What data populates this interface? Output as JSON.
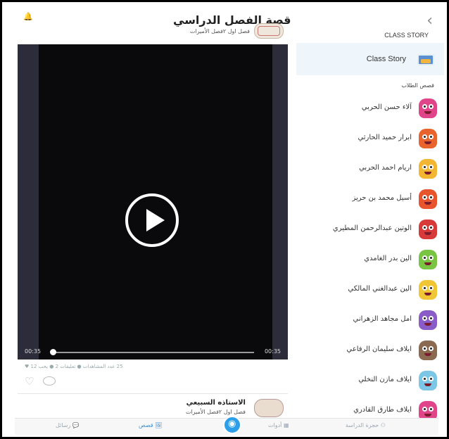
{
  "header": {
    "title": "قصة الفصل الدراسي",
    "back_icon": "chevron-left-icon",
    "class_story_caption": "CLASS STORY"
  },
  "feed": {
    "post1": {
      "subtitle": "فصل اول ٢فصل الأميرات",
      "avatar_text": "الاستاذة السبيعي",
      "video": {
        "time_elapsed": "00:35",
        "time_total": "00:35",
        "progress": 0.0
      },
      "stats": "25 عدد المشاهدات ● تعليقات 2 ● يحب 12 ♥"
    },
    "post2": {
      "author": "الاستاذه السبيعي",
      "subtitle": "فصل اول ٢فصل الأميرات",
      "ago": "712d"
    }
  },
  "sidebar": {
    "class_story_label": "Class Story",
    "section_caption": "قصص الطلاب",
    "students": [
      {
        "name": "آلاء حسن الحربي",
        "color": "#e0458a"
      },
      {
        "name": "ابرار حميد الحارثي",
        "color": "#e8642c"
      },
      {
        "name": "اريام احمد الحربي",
        "color": "#f2b632"
      },
      {
        "name": "أسيل محمد بن حريز",
        "color": "#e8542c"
      },
      {
        "name": "الوتين عبدالرحمن المطيري",
        "color": "#d83a3a"
      },
      {
        "name": "الين بدر الغامدي",
        "color": "#7ac443"
      },
      {
        "name": "الين عبدالغني المالكي",
        "color": "#f0c634"
      },
      {
        "name": "امل مجاهد الزهراني",
        "color": "#8a5cc8"
      },
      {
        "name": "ايلاف سليمان الرفاعي",
        "color": "#8b6a52"
      },
      {
        "name": "ايلاف مازن النخلي",
        "color": "#7cc6e6"
      },
      {
        "name": "ايلاف طارق القادري",
        "color": "#e0458a"
      }
    ]
  },
  "bottom_nav": {
    "messages": "رسائل",
    "stories": "قصص",
    "toolbox": "أدوات",
    "classroom": "حجرة الدراسة"
  },
  "colors": {
    "accent": "#2d9fe8",
    "active_tab": "#3c8fd8"
  }
}
